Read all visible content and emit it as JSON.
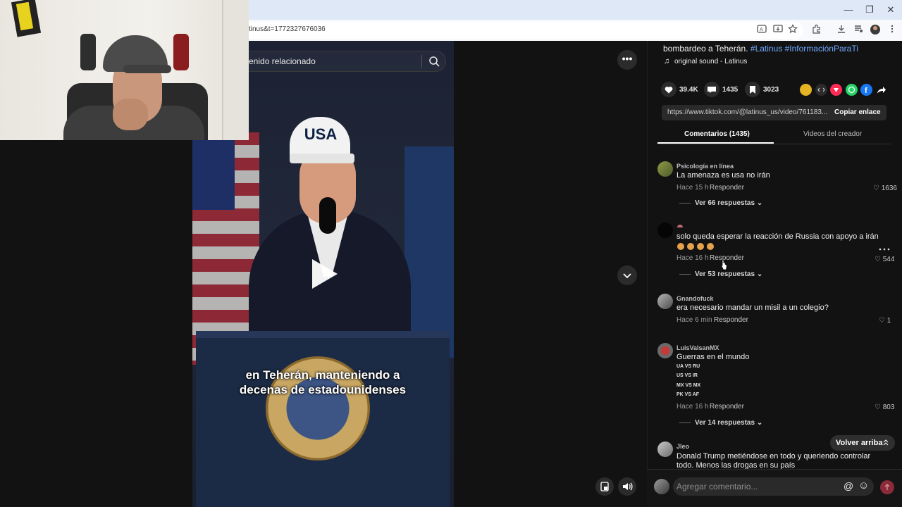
{
  "browser": {
    "url": "tinus&t=1772327676036",
    "window_controls": {
      "minimize": "—",
      "restore": "❐",
      "close": "✕"
    }
  },
  "video": {
    "search_text": "enido relacionado",
    "caption_line1": "en Teherán, manteniendo a",
    "caption_line2": "decenas de estadounidenses",
    "cap_text": "USA",
    "more_label": "•••"
  },
  "description": {
    "line1": "bombardeo a Teherán.",
    "hashtag1": "#Latinus",
    "hashtag2": "#InformaciónParaTi",
    "sound": "original sound - Latinus"
  },
  "stats": {
    "likes": "39.4K",
    "comments": "1435",
    "saves": "3023"
  },
  "share": {
    "link": "https://www.tiktok.com/@latinus_us/video/761183...",
    "copy_label": "Copiar enlace",
    "colors": {
      "embed": "#2b2b2b",
      "pink": "#fe2c55",
      "whatsapp": "#25d366",
      "facebook": "#1877f2",
      "gold": "#e6b325"
    }
  },
  "tabs": {
    "comments": "Comentarios (1435)",
    "creator_videos": "Videos del creador"
  },
  "comments": [
    {
      "user": "Psicología en línea",
      "text": "La amenaza es usa no irán",
      "time": "Hace 15 h",
      "reply": "Responder",
      "likes": "1636",
      "replies": "Ver 66 respuestas"
    },
    {
      "user": "",
      "text": "solo queda esperar la reacción de Russia con apoyo a irán",
      "time": "Hace 16 h",
      "reply": "Responder",
      "likes": "544",
      "replies": "Ver 53 respuestas"
    },
    {
      "user": "Gnandofuck",
      "text": "era necesario mandar un misil a un colegio?",
      "time": "Hace 6 min",
      "reply": "Responder",
      "likes": "1"
    },
    {
      "user": "LuisValsanMX",
      "text": "Guerras en el mundo",
      "lines": [
        "UA VS RU",
        "US VS IR",
        "MX VS MX",
        "PK VS AF"
      ],
      "time": "Hace 16 h",
      "reply": "Responder",
      "likes": "803",
      "replies": "Ver 14 respuestas"
    },
    {
      "user": "Jleo",
      "text1": "Donald Trump metiéndose en todo y queriendo controlar",
      "text2": "todo. Menos las drogas en su país"
    }
  ],
  "back_to_top": "Volver arriba",
  "comment_input_placeholder": "Agregar comentario...",
  "icons": {
    "heart": "♡",
    "at": "@",
    "smile": "☺",
    "chevron": "⌄",
    "music": "♫"
  }
}
